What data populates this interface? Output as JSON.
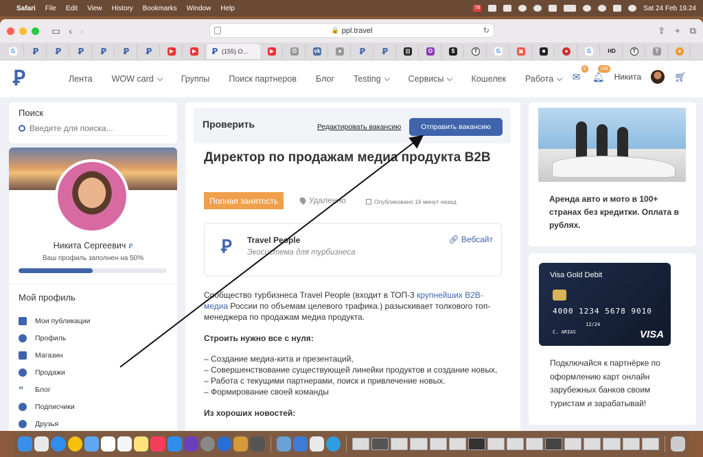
{
  "menubar": {
    "app": "Safari",
    "items": [
      "File",
      "Edit",
      "View",
      "History",
      "Bookmarks",
      "Window",
      "Help"
    ],
    "clock": "Sat 24 Feb  19.24",
    "badge": "78"
  },
  "browser": {
    "url": "ppl.travel",
    "active_tab": "(155) O...",
    "favicons": [
      "G",
      "P",
      "P",
      "P",
      "P",
      "P",
      "P",
      "YT",
      "YT",
      "YT",
      "O",
      "VK",
      "P",
      "P",
      "P",
      "P",
      "G",
      "G",
      "G",
      "G",
      "G",
      "HD",
      "T",
      "T",
      "G"
    ]
  },
  "site": {
    "logo": "Ꝑ",
    "nav": [
      {
        "label": "Лента",
        "dropdown": false
      },
      {
        "label": "WOW card",
        "dropdown": true
      },
      {
        "label": "Группы",
        "dropdown": false
      },
      {
        "label": "Поиск партнеров",
        "dropdown": false
      },
      {
        "label": "Блог",
        "dropdown": false
      },
      {
        "label": "Testing",
        "dropdown": true
      },
      {
        "label": "Сервисы",
        "dropdown": true
      },
      {
        "label": "Кошелек",
        "dropdown": false
      },
      {
        "label": "Работа",
        "dropdown": true
      }
    ],
    "messages_badge": "6",
    "notifications_badge": "149",
    "user_name": "Никита"
  },
  "search": {
    "title": "Поиск",
    "placeholder": "Введите для поиска..."
  },
  "profile": {
    "name": "Никита Сергеевич",
    "fill_text": "Ваш профиль заполнен на 50%",
    "fill_percent": 50,
    "section_title": "Мой профиль",
    "menu": [
      {
        "label": "Мои публикации",
        "icon": "home-icon"
      },
      {
        "label": "Профиль",
        "icon": "user-icon"
      },
      {
        "label": "Магазин",
        "icon": "shop-icon"
      },
      {
        "label": "Продажи",
        "icon": "gauge-icon"
      },
      {
        "label": "Блог",
        "icon": "quote-icon"
      },
      {
        "label": "Подписчики",
        "icon": "user-check-icon"
      },
      {
        "label": "Друзья",
        "icon": "users-icon"
      }
    ]
  },
  "job": {
    "check_title": "Проверить",
    "edit_link": "Редактировать вакансию",
    "send_button": "Отправить вакансию",
    "title": "Директор по продажам медиа продукта B2B",
    "employment": "Полная занятость",
    "location": "Удаленно",
    "published": "Опубликовано 16 минут назад",
    "company": {
      "name": "Travel People",
      "tagline": "Экосистема для турбизнеса",
      "website_label": "Вебсайт"
    },
    "intro_before": "Сообщество турбизнеса Travel People (входит в ТОП-3 ",
    "intro_link": "крупнейших B2B-медиа",
    "intro_after": " России по объемам целевого трафика.) разыскивает толкового топ-менеджера по продажам медиа продукта.",
    "section1": "Строить нужно все с нуля:",
    "bullets": [
      "– Создание медиа-кита и презентаций,",
      "– Совершенствование существующей линейки продуктов и создание новых,",
      "– Работа с текущими партнерами, поиск и привлечение новых.",
      "– Формирование своей команды"
    ],
    "section2": "Из хороших новостей:"
  },
  "ads": {
    "car_rental": "Аренда авто и мото в 100+ странах без кредитки. Оплата в рублях.",
    "card": {
      "brand_name": "Visa Gold Debit",
      "number": "4000 1234 5678 9010",
      "expiry": "12/24",
      "holder": "C. ARIAS",
      "network": "VISA"
    },
    "card_text": "Подключайся к партнёрке по оформлению карт онлайн зарубежных банков своим туристам и зарабатывай!"
  },
  "colors": {
    "brand": "#3f64ac",
    "accent": "#f0a04b"
  }
}
